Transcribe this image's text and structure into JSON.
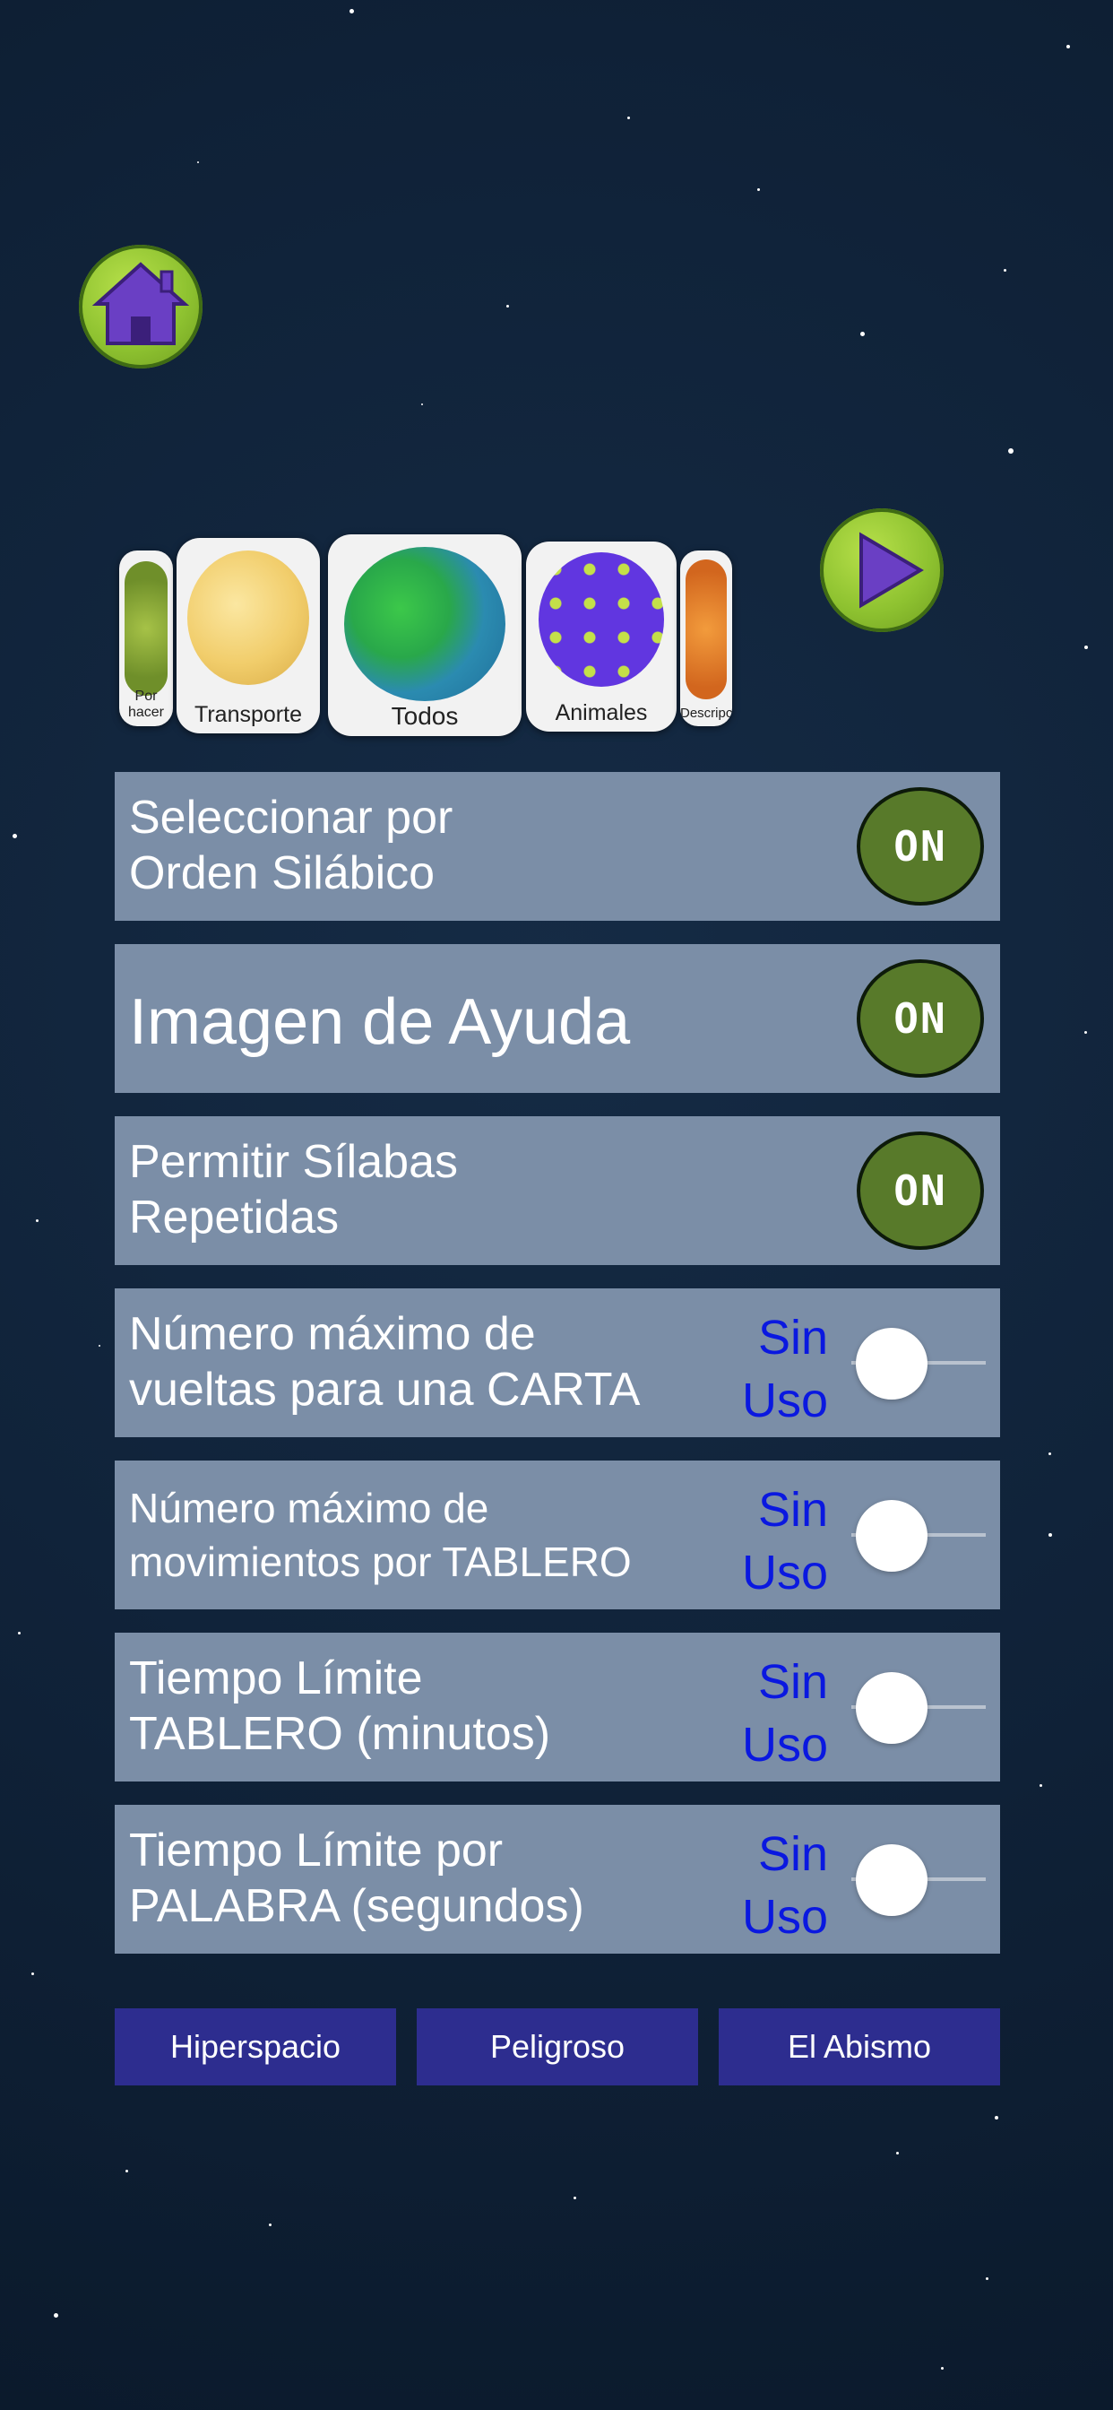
{
  "carousel": {
    "cards": [
      {
        "label": "Por hacer"
      },
      {
        "label": "Transporte"
      },
      {
        "label": "Todos"
      },
      {
        "label": "Animales"
      },
      {
        "label": "Descripción"
      }
    ]
  },
  "settings": [
    {
      "label_line1": "Seleccionar por",
      "label_line2": "Orden Silábico",
      "toggle": "ON"
    },
    {
      "label_line1": "Imagen de Ayuda",
      "label_line2": "",
      "toggle": "ON"
    },
    {
      "label_line1": "Permitir Sílabas",
      "label_line2": "Repetidas",
      "toggle": "ON"
    },
    {
      "label_line1": "Número máximo de",
      "label_line2": "vueltas para una CARTA",
      "value_line1": "Sin",
      "value_line2": "Uso"
    },
    {
      "label_line1": "Número máximo de",
      "label_line2": "movimientos por TABLERO",
      "value_line1": "Sin",
      "value_line2": "Uso"
    },
    {
      "label_line1": "Tiempo Límite",
      "label_line2": "TABLERO (minutos)",
      "value_line1": "Sin",
      "value_line2": "Uso"
    },
    {
      "label_line1": "Tiempo Límite por",
      "label_line2": "PALABRA (segundos)",
      "value_line1": "Sin",
      "value_line2": "Uso"
    }
  ],
  "modes": [
    {
      "label": "Hiperspacio"
    },
    {
      "label": "Peligroso"
    },
    {
      "label": "El Abismo"
    }
  ],
  "icons": {
    "home": "home-icon",
    "play": "play-icon"
  },
  "colors": {
    "background": "#0f2137",
    "panel": "#7b8ea7",
    "on_button": "#587a2a",
    "sin_uso_text": "#0a18e0",
    "mode_button": "#2d2d8f",
    "icon_green": "#8ec230",
    "icon_purple": "#6a3fc4"
  }
}
